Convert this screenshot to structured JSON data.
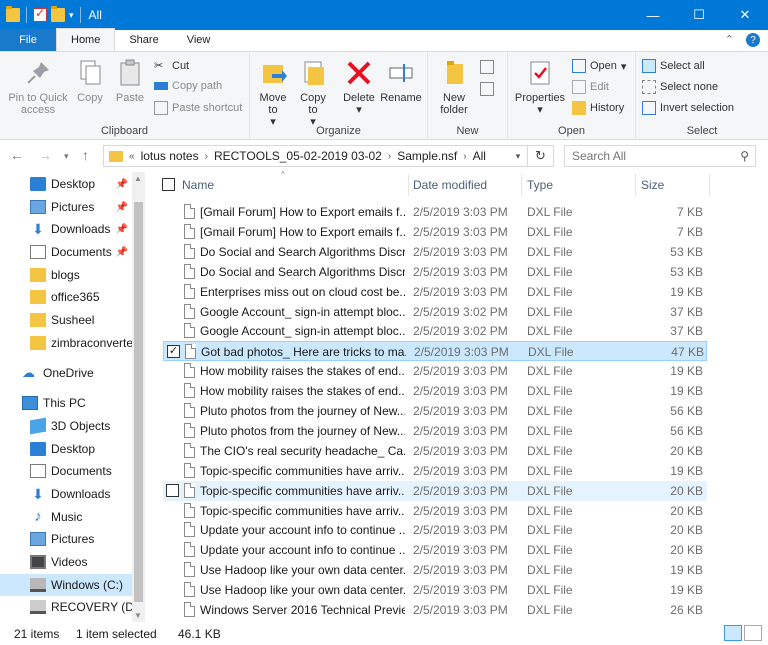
{
  "window": {
    "title": "All",
    "controls": {
      "minimize": "—",
      "maximize": "☐",
      "close": "✕"
    }
  },
  "ribbon": {
    "tabs": [
      "File",
      "Home",
      "Share",
      "View"
    ],
    "active_tab": "Home",
    "groups": {
      "clipboard": {
        "label": "Clipboard",
        "pin_to_quick_access": "Pin to Quick access",
        "copy": "Copy",
        "paste": "Paste",
        "cut": "Cut",
        "copy_path": "Copy path",
        "paste_shortcut": "Paste shortcut"
      },
      "organize": {
        "label": "Organize",
        "move_to": "Move to",
        "copy_to": "Copy to",
        "delete": "Delete",
        "rename": "Rename"
      },
      "new": {
        "label": "New",
        "new_folder": "New folder"
      },
      "open": {
        "label": "Open",
        "properties": "Properties",
        "open": "Open",
        "edit": "Edit",
        "history": "History"
      },
      "select": {
        "label": "Select",
        "select_all": "Select all",
        "select_none": "Select none",
        "invert_selection": "Invert selection"
      }
    }
  },
  "address": {
    "breadcrumbs": [
      "lotus notes",
      "RECTOOLS_05-02-2019 03-02",
      "Sample.nsf",
      "All"
    ],
    "search_placeholder": "Search All"
  },
  "nav": {
    "quick_access": [
      {
        "label": "Desktop",
        "icon": "desktop-icon",
        "pinned": true
      },
      {
        "label": "Pictures",
        "icon": "pictures-icon",
        "pinned": true
      },
      {
        "label": "Downloads",
        "icon": "downloads-icon",
        "pinned": true
      },
      {
        "label": "Documents",
        "icon": "documents-icon",
        "pinned": true
      },
      {
        "label": "blogs",
        "icon": "folder-icon",
        "pinned": false
      },
      {
        "label": "office365",
        "icon": "folder-icon",
        "pinned": false
      },
      {
        "label": "Susheel",
        "icon": "folder-icon",
        "pinned": false
      },
      {
        "label": "zimbraconverter",
        "icon": "folder-icon",
        "pinned": false
      }
    ],
    "onedrive": "OneDrive",
    "this_pc": "This PC",
    "this_pc_items": [
      {
        "label": "3D Objects",
        "icon": "3d-objects-icon"
      },
      {
        "label": "Desktop",
        "icon": "desktop-icon"
      },
      {
        "label": "Documents",
        "icon": "documents-icon"
      },
      {
        "label": "Downloads",
        "icon": "downloads-icon"
      },
      {
        "label": "Music",
        "icon": "music-icon"
      },
      {
        "label": "Pictures",
        "icon": "pictures-icon"
      },
      {
        "label": "Videos",
        "icon": "videos-icon"
      },
      {
        "label": "Windows (C:)",
        "icon": "drive-icon"
      },
      {
        "label": "RECOVERY (D:)",
        "icon": "drive-icon"
      }
    ]
  },
  "columns": {
    "name": "Name",
    "date": "Date modified",
    "type": "Type",
    "size": "Size"
  },
  "files": [
    {
      "name": "[Gmail Forum] How to Export emails f...",
      "date": "2/5/2019 3:03 PM",
      "type": "DXL File",
      "size": "7 KB"
    },
    {
      "name": "[Gmail Forum] How to Export emails f...",
      "date": "2/5/2019 3:03 PM",
      "type": "DXL File",
      "size": "7 KB"
    },
    {
      "name": "Do Social and Search Algorithms Discr...",
      "date": "2/5/2019 3:03 PM",
      "type": "DXL File",
      "size": "53 KB"
    },
    {
      "name": "Do Social and Search Algorithms Discr...",
      "date": "2/5/2019 3:03 PM",
      "type": "DXL File",
      "size": "53 KB"
    },
    {
      "name": "Enterprises miss out on cloud cost be...",
      "date": "2/5/2019 3:03 PM",
      "type": "DXL File",
      "size": "19 KB"
    },
    {
      "name": "Google Account_ sign-in attempt bloc...",
      "date": "2/5/2019 3:02 PM",
      "type": "DXL File",
      "size": "37 KB"
    },
    {
      "name": "Google Account_ sign-in attempt bloc...",
      "date": "2/5/2019 3:02 PM",
      "type": "DXL File",
      "size": "37 KB"
    },
    {
      "name": "Got bad photos_ Here are tricks to ma...",
      "date": "2/5/2019 3:03 PM",
      "type": "DXL File",
      "size": "47 KB"
    },
    {
      "name": "How mobility raises the stakes of end...",
      "date": "2/5/2019 3:03 PM",
      "type": "DXL File",
      "size": "19 KB"
    },
    {
      "name": "How mobility raises the stakes of end...",
      "date": "2/5/2019 3:03 PM",
      "type": "DXL File",
      "size": "19 KB"
    },
    {
      "name": "Pluto photos from the journey of New...",
      "date": "2/5/2019 3:03 PM",
      "type": "DXL File",
      "size": "56 KB"
    },
    {
      "name": "Pluto photos from the journey of New...",
      "date": "2/5/2019 3:03 PM",
      "type": "DXL File",
      "size": "56 KB"
    },
    {
      "name": "The CIO's real security headache_ Ca...",
      "date": "2/5/2019 3:03 PM",
      "type": "DXL File",
      "size": "20 KB"
    },
    {
      "name": "Topic-specific communities have arriv...",
      "date": "2/5/2019 3:03 PM",
      "type": "DXL File",
      "size": "19 KB"
    },
    {
      "name": "Topic-specific communities have arriv...",
      "date": "2/5/2019 3:03 PM",
      "type": "DXL File",
      "size": "20 KB"
    },
    {
      "name": "Topic-specific communities have arriv...",
      "date": "2/5/2019 3:03 PM",
      "type": "DXL File",
      "size": "20 KB"
    },
    {
      "name": "Update your account info to continue ...",
      "date": "2/5/2019 3:03 PM",
      "type": "DXL File",
      "size": "20 KB"
    },
    {
      "name": "Update your account info to continue ...",
      "date": "2/5/2019 3:03 PM",
      "type": "DXL File",
      "size": "20 KB"
    },
    {
      "name": "Use Hadoop like your own data center...",
      "date": "2/5/2019 3:03 PM",
      "type": "DXL File",
      "size": "19 KB"
    },
    {
      "name": "Use Hadoop like your own data center...",
      "date": "2/5/2019 3:03 PM",
      "type": "DXL File",
      "size": "19 KB"
    },
    {
      "name": "Windows Server 2016 Technical Previe...",
      "date": "2/5/2019 3:03 PM",
      "type": "DXL File",
      "size": "26 KB"
    }
  ],
  "selected_file_index": 7,
  "hover_file_index": 14,
  "status": {
    "items": "21 items",
    "selected": "1 item selected",
    "selected_size": "46.1 KB"
  }
}
